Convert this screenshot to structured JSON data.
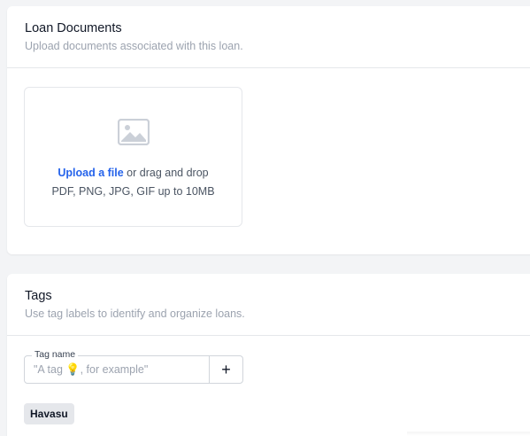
{
  "documents": {
    "title": "Loan Documents",
    "subtitle": "Upload documents associated with this loan.",
    "upload_link": "Upload a file",
    "upload_rest": " or drag and drop",
    "hint": "PDF, PNG, JPG, GIF up to 10MB",
    "icon": "image-icon"
  },
  "tags": {
    "title": "Tags",
    "subtitle": "Use tag labels to identify and organize loans.",
    "input_label": "Tag name",
    "placeholder_prefix": "\"A tag ",
    "placeholder_emoji": "💡",
    "placeholder_suffix": ", for example\"",
    "add_label": "+",
    "items": [
      "Havasu"
    ]
  },
  "colors": {
    "accent": "#2563eb",
    "background": "#f3f4f6",
    "chip": "#e5e7eb"
  }
}
